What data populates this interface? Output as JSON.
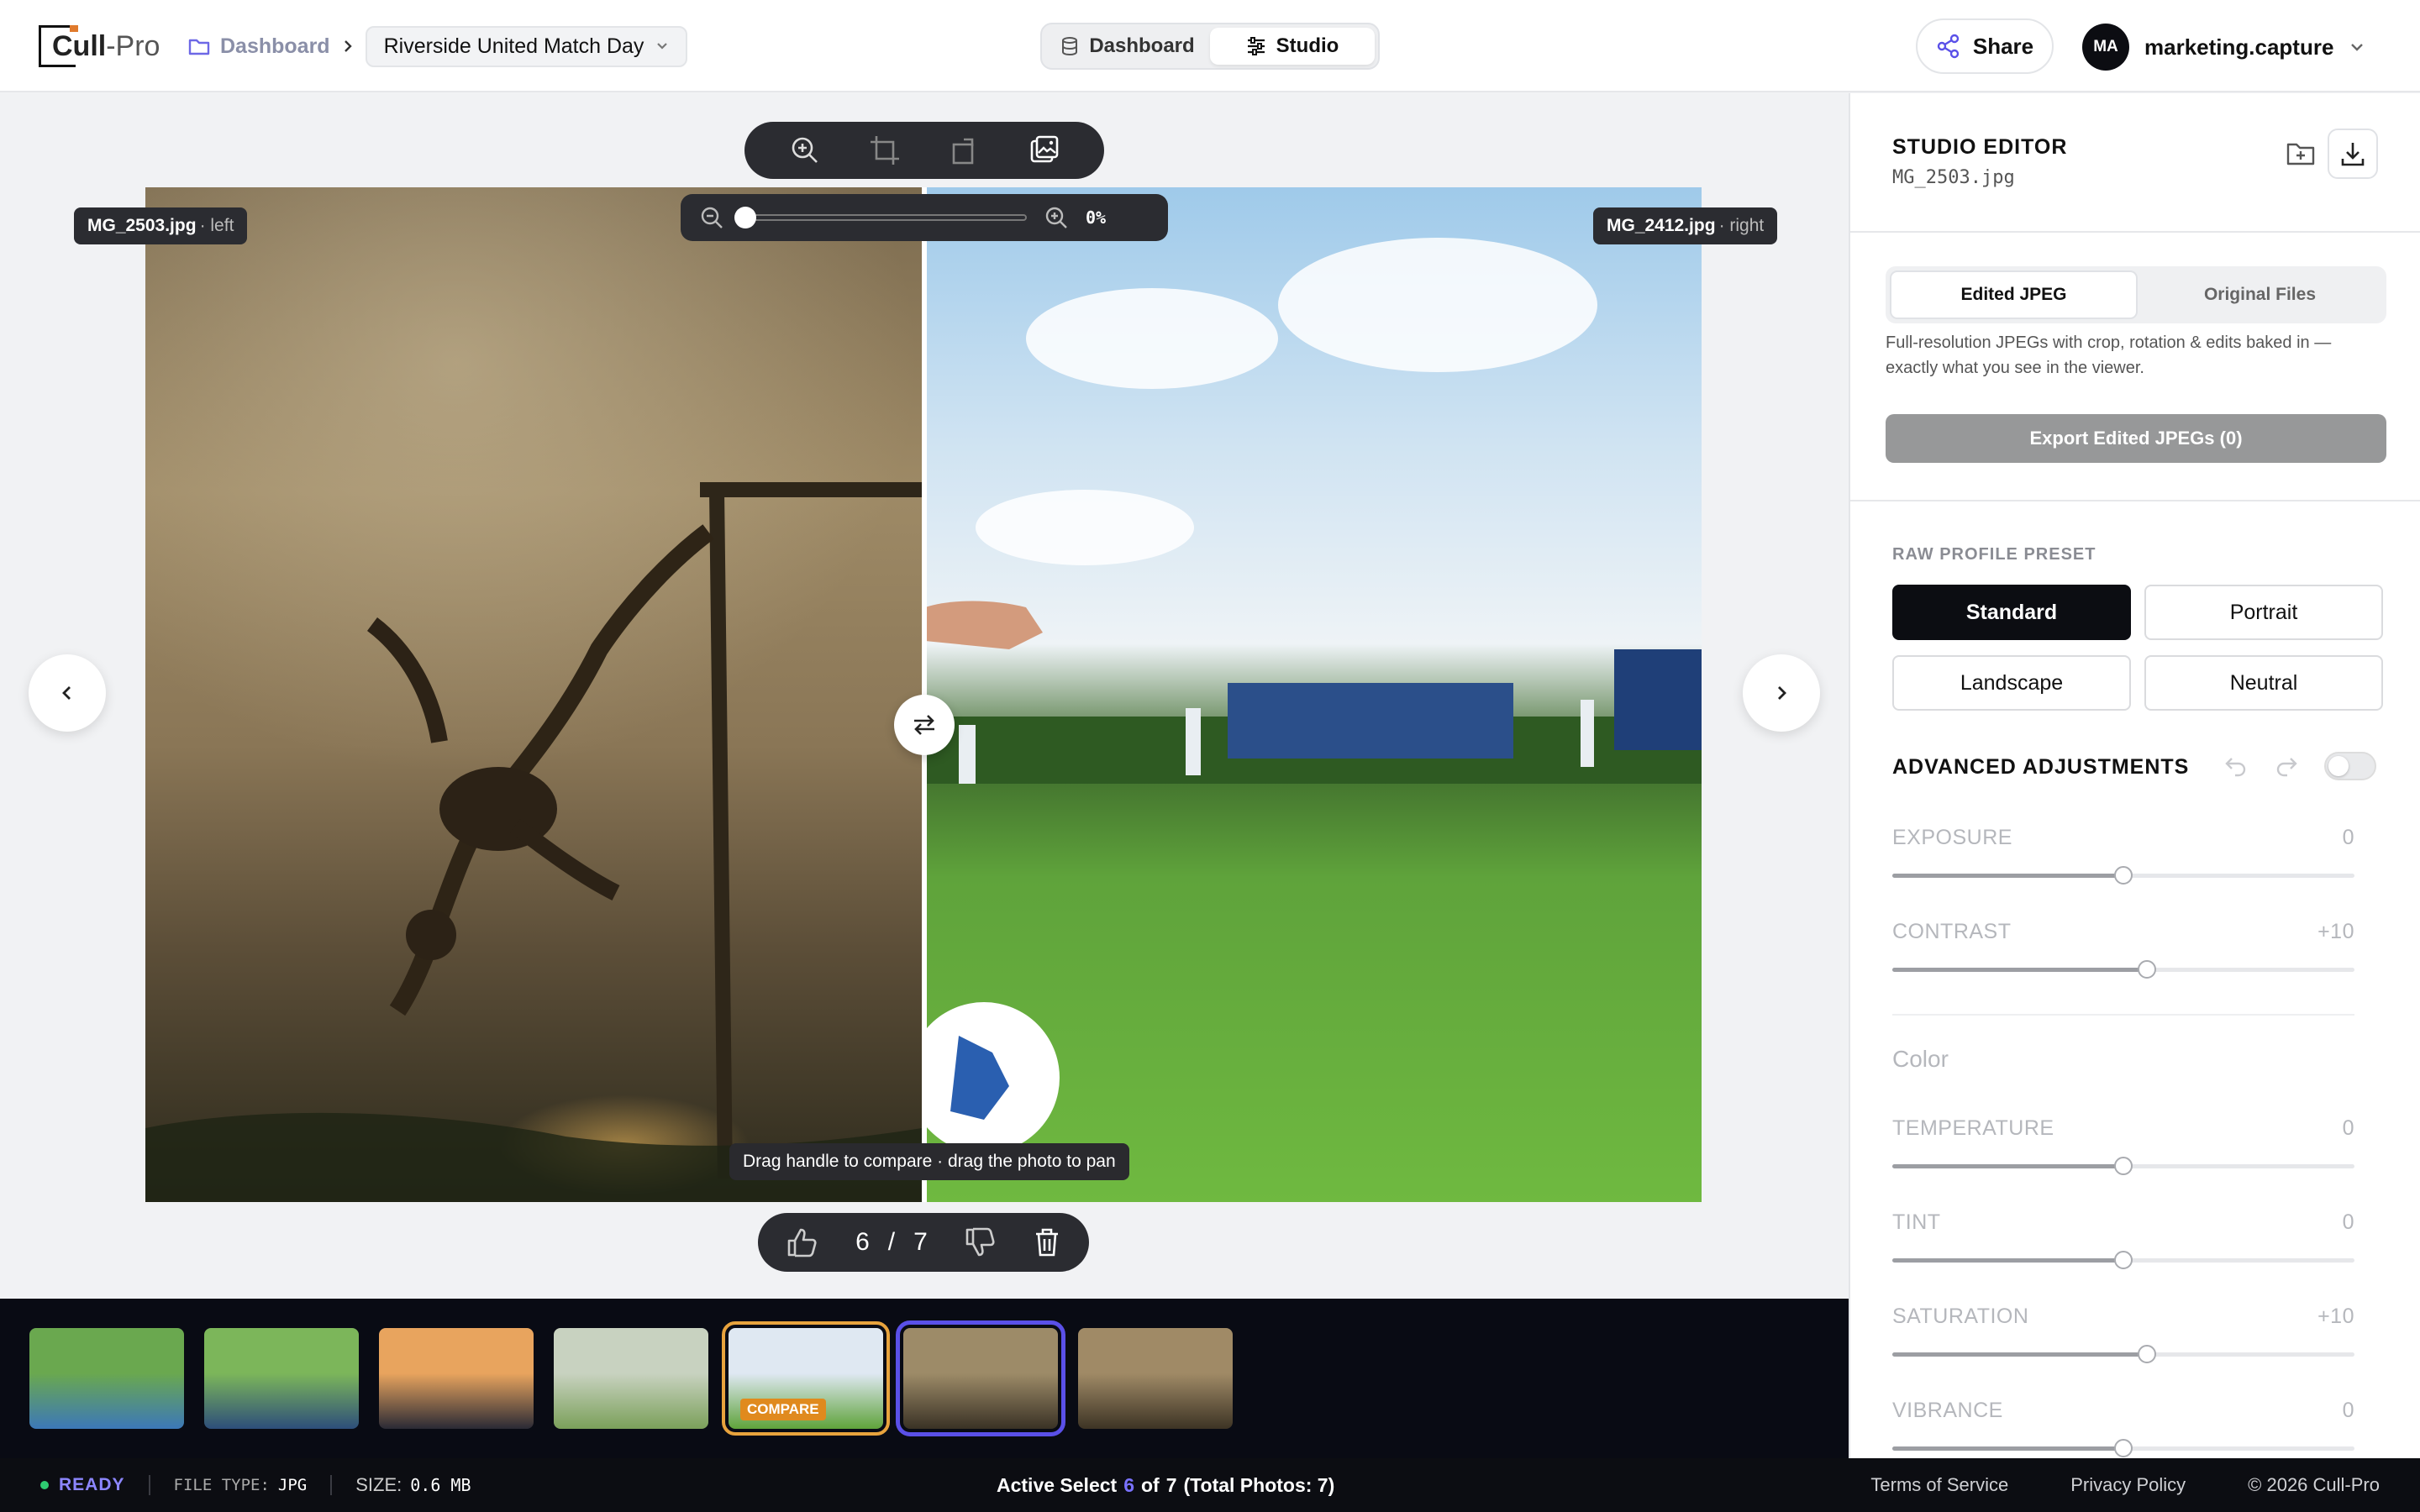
{
  "header": {
    "logo_text_1": "Cull",
    "logo_text_2": "-Pro",
    "breadcrumb_dashboard": "Dashboard",
    "project_name": "Riverside United Match Day",
    "segment_dashboard": "Dashboard",
    "segment_studio": "Studio",
    "share_label": "Share",
    "avatar_initials": "MA",
    "username": "marketing.capture"
  },
  "viewer": {
    "zoom_percent": "0%",
    "zoom_level": 0,
    "left_file": "MG_2503.jpg",
    "left_side": "· left",
    "right_file": "MG_2412.jpg",
    "right_side": "· right",
    "hint": "Drag handle to compare · drag the photo to pan",
    "current_index": "6",
    "separator": "/",
    "total": "7"
  },
  "filmstrip": {
    "compare_badge": "COMPARE",
    "thumbnails": [
      {
        "colors": [
          "#6aa84f",
          "#3c78b8"
        ]
      },
      {
        "colors": [
          "#7cb65a",
          "#2d4e7a"
        ]
      },
      {
        "colors": [
          "#e8a45e",
          "#2a2a35"
        ]
      },
      {
        "colors": [
          "#c8d2c0",
          "#7ba05a"
        ]
      },
      {
        "colors": [
          "#dfe8f2",
          "#5fa33b"
        ],
        "state": "compare"
      },
      {
        "colors": [
          "#9d8b68",
          "#3a3225"
        ],
        "state": "active"
      },
      {
        "colors": [
          "#a08a66",
          "#3d3425"
        ]
      }
    ]
  },
  "status": {
    "ready": "READY",
    "file_type_label": "FILE TYPE:",
    "file_type_value": "JPG",
    "size_label": "SIZE:",
    "size_value": "0.6 MB",
    "active_prefix": "Active Select",
    "active_index": "6",
    "active_of": "of",
    "active_total": "7",
    "active_suffix": "(Total Photos: 7)",
    "terms": "Terms of Service",
    "privacy": "Privacy Policy",
    "copyright": "© 2026 Cull-Pro"
  },
  "panel": {
    "title": "STUDIO EDITOR",
    "filename": "MG_2503.jpg",
    "tab_edited": "Edited JPEG",
    "tab_original": "Original Files",
    "description": "Full-resolution JPEGs with crop, rotation & edits baked in — exactly what you see in the viewer.",
    "export_label": "Export Edited JPEGs (0)",
    "preset_label": "RAW PROFILE PRESET",
    "presets": [
      "Standard",
      "Portrait",
      "Landscape",
      "Neutral"
    ],
    "advanced_label": "ADVANCED ADJUSTMENTS",
    "color_label": "Color",
    "sliders": [
      {
        "label": "EXPOSURE",
        "value": "0",
        "level": 0.5
      },
      {
        "label": "CONTRAST",
        "value": "+10",
        "level": 0.55
      },
      {
        "label": "TEMPERATURE",
        "value": "0",
        "level": 0.5
      },
      {
        "label": "TINT",
        "value": "0",
        "level": 0.5
      },
      {
        "label": "SATURATION",
        "value": "+10",
        "level": 0.55
      },
      {
        "label": "VIBRANCE",
        "value": "0",
        "level": 0.5
      }
    ]
  },
  "colors": {
    "accent": "#5a50e8",
    "compare": "#e8a33d",
    "ready": "#2ecc71"
  }
}
